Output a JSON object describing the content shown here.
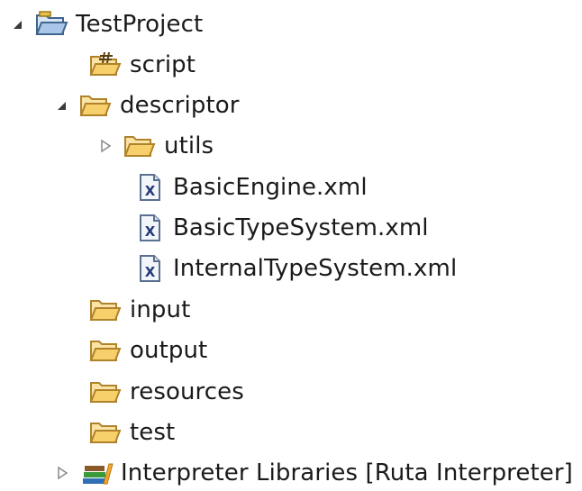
{
  "tree": {
    "items": [
      {
        "label": "TestProject",
        "icon": "project-folder-icon",
        "toggle": "expanded"
      },
      {
        "label": "script",
        "icon": "script-folder-icon",
        "toggle": "none"
      },
      {
        "label": "descriptor",
        "icon": "folder-icon",
        "toggle": "expanded"
      },
      {
        "label": "utils",
        "icon": "folder-icon",
        "toggle": "collapsed"
      },
      {
        "label": "BasicEngine.xml",
        "icon": "xml-file-icon",
        "toggle": "none"
      },
      {
        "label": "BasicTypeSystem.xml",
        "icon": "xml-file-icon",
        "toggle": "none"
      },
      {
        "label": "InternalTypeSystem.xml",
        "icon": "xml-file-icon",
        "toggle": "none"
      },
      {
        "label": "input",
        "icon": "folder-icon",
        "toggle": "none"
      },
      {
        "label": "output",
        "icon": "folder-icon",
        "toggle": "none"
      },
      {
        "label": "resources",
        "icon": "folder-icon",
        "toggle": "none"
      },
      {
        "label": "test",
        "icon": "folder-icon",
        "toggle": "none"
      },
      {
        "label": "Interpreter Libraries [Ruta Interpreter]",
        "icon": "library-icon",
        "toggle": "collapsed"
      }
    ]
  }
}
